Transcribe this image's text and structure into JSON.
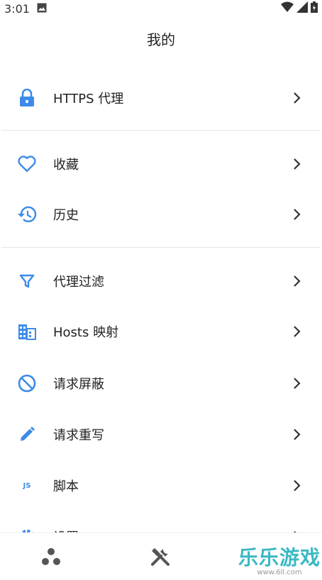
{
  "statusbar": {
    "time": "3:01"
  },
  "page": {
    "title": "我的"
  },
  "menu": {
    "items": [
      {
        "label": "HTTPS 代理"
      },
      {
        "label": "收藏"
      },
      {
        "label": "历史"
      },
      {
        "label": "代理过滤"
      },
      {
        "label": "Hosts 映射"
      },
      {
        "label": "请求屏蔽"
      },
      {
        "label": "请求重写"
      },
      {
        "label": "脚本",
        "icon_text": "JS"
      },
      {
        "label": "设置"
      }
    ]
  },
  "colors": {
    "accent": "#3d8be8",
    "text": "#222222",
    "divider": "#e6e6e6"
  },
  "watermark": {
    "main": "乐乐游戏",
    "sub": "www.6ll.com"
  }
}
